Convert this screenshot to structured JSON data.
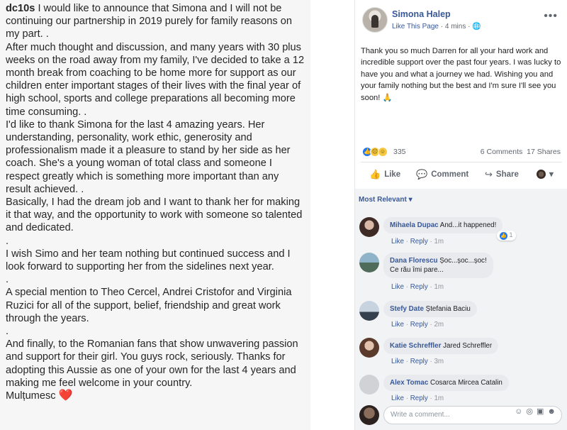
{
  "instagram": {
    "username": "dc10s",
    "paragraphs": [
      " I would like to announce that Simona and I will not be continuing our partnership in 2019 purely for family reasons on my part. .",
      "After much thought and discussion, and many years with 30 plus weeks on the road away from my family, I've decided to take a 12 month break from coaching to be home more for support as our children enter important stages of their lives with the final year of high school, sports and college preparations all becoming more time consuming. .",
      "I'd like to thank Simona for the last 4 amazing years. Her understanding, personality, work ethic, generosity and professionalism made it a pleasure to stand by her side as her coach. She's a young woman of total class and someone I respect greatly which is something more important than any result achieved. .",
      "Basically, I had the dream job and I want to thank her for making it that way, and the opportunity to work with someone so talented and dedicated.",
      ".",
      "I wish Simo and her team nothing but continued success and I look forward to supporting her from the sidelines next year.",
      ".",
      "A special mention to Theo Cercel, Andrei Cristofor and Virginia Ruzici for all of the support, belief, friendship and great work through the years.",
      ".",
      "And finally, to the Romanian fans that show unwavering passion and support for their girl. You guys rock, seriously. Thanks for adopting this Aussie as one of your own for the last 4 years and making me feel welcome in your country.",
      "Mulțumesc"
    ],
    "heart": "❤️"
  },
  "facebook": {
    "page_name": "Simona Halep",
    "like_page": "Like This Page",
    "time": "4 mins",
    "post_text": "Thank you so much Darren for all your hard work and incredible support over the past four years. I was lucky to have you and what a journey we had. Wishing you and your family nothing but the best and I'm sure I'll see you soon!",
    "post_emoji": "🙏",
    "reaction_count": "335",
    "comments_count": "6 Comments",
    "shares_count": "17 Shares",
    "actions": {
      "like": "Like",
      "comment": "Comment",
      "share": "Share"
    },
    "most_relevant": "Most Relevant ▾",
    "comments": [
      {
        "name": "Mihaela Dupac",
        "text": "And...it happened!",
        "line2": "",
        "like": "Like",
        "reply": "Reply",
        "time": "1m",
        "reactions": "1"
      },
      {
        "name": "Dana Florescu",
        "text": "Șoc...șoc...șoc!",
        "line2": "Ce rău îmi pare...",
        "like": "Like",
        "reply": "Reply",
        "time": "1m",
        "reactions": ""
      },
      {
        "name": "Stefy Date",
        "text": "Ștefania Baciu",
        "line2": "",
        "like": "Like",
        "reply": "Reply",
        "time": "2m",
        "reactions": ""
      },
      {
        "name": "Katie Schreffler",
        "text": "Jared Schreffler",
        "line2": "",
        "like": "Like",
        "reply": "Reply",
        "time": "3m",
        "reactions": ""
      },
      {
        "name": "Alex Tomac",
        "text": "Cosarca Mircea Catalin",
        "line2": "",
        "like": "Like",
        "reply": "Reply",
        "time": "1m",
        "reactions": ""
      }
    ],
    "write_placeholder": "Write a comment...",
    "colors": {
      "link": "#385898",
      "like_blue": "#2078f4",
      "bubble": "#e8eaee"
    }
  }
}
